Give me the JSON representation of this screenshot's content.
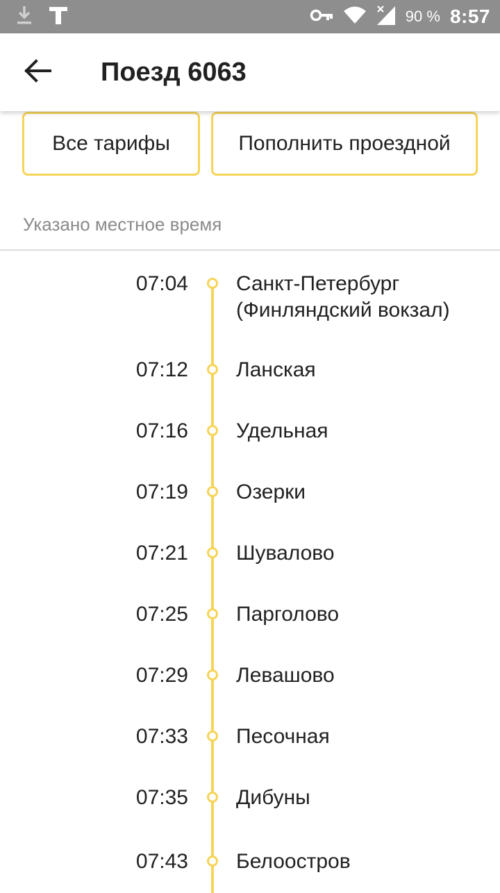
{
  "status_bar": {
    "battery_text": "90 %",
    "clock": "8:57",
    "icons": [
      "download-icon",
      "t-app-icon",
      "vpn-key-icon",
      "wifi-icon",
      "cell-signal-icon"
    ]
  },
  "header": {
    "back_icon": "arrow-left-icon",
    "title": "Поезд 6063"
  },
  "actions": {
    "all_tariffs": "Все тарифы",
    "top_up_pass": "Пополнить проездной"
  },
  "note": "Указано местное время",
  "colors": {
    "accent": "#f6d458",
    "text": "#212121",
    "muted": "#8a8a8a",
    "status_bar": "#8e8e8e"
  },
  "stops": [
    {
      "time": "07:04",
      "name_line1": "Санкт-Петербург",
      "name_line2": "(Финляндский вокзал)"
    },
    {
      "time": "07:12",
      "name": "Ланская"
    },
    {
      "time": "07:16",
      "name": "Удельная"
    },
    {
      "time": "07:19",
      "name": "Озерки"
    },
    {
      "time": "07:21",
      "name": "Шувалово"
    },
    {
      "time": "07:25",
      "name": "Парголово"
    },
    {
      "time": "07:29",
      "name": "Левашово"
    },
    {
      "time": "07:33",
      "name": "Песочная"
    },
    {
      "time": "07:35",
      "name": "Дибуны"
    },
    {
      "time": "07:43",
      "name": "Белоостров"
    }
  ]
}
